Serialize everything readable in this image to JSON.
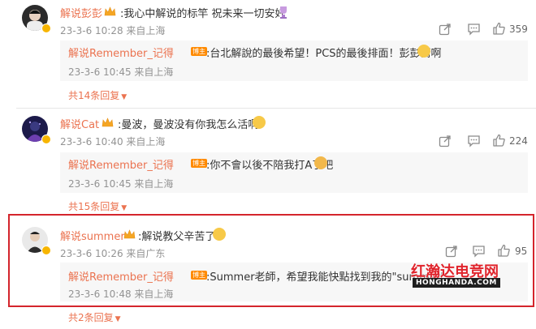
{
  "comments": [
    {
      "user": "解说彭彭",
      "text": ":我心中解说的标竿 祝未来一切安好",
      "time": "23-3-6 10:28 来自上海",
      "likes": "359",
      "reply": {
        "user": "解说Remember_记得",
        "tag": "博主",
        "text": ":台北解說的最後希望！PCS的最後排面！彭彭衝啊",
        "time": "23-3-6 10:45 来自上海"
      },
      "more": "共14条回复"
    },
    {
      "user": "解说Cat",
      "text": ":曼波，曼波没有你我怎么活啊",
      "time": "23-3-6 10:40 来自上海",
      "likes": "224",
      "reply": {
        "user": "解说Remember_记得",
        "tag": "博主",
        "text": ":你不會以後不陪我打A了吧",
        "time": "23-3-6 10:45 来自上海"
      },
      "more": "共15条回复"
    },
    {
      "user": "解说summer",
      "text": ":解说教父辛苦了",
      "time": "23-3-6 10:26 来自广东",
      "likes": "95",
      "reply": {
        "user": "解说Remember_记得",
        "tag": "博主",
        "text": ":Summer老師，希望我能快點找到我的\"summer\"",
        "time": "23-3-6 10:48 来自上海"
      },
      "more": "共2条回复"
    }
  ],
  "watermark": {
    "title": "红瀚达电竞网",
    "url": "HONGHANDA.COM"
  },
  "colors": {
    "username": "#eb7350",
    "highlight_border": "#d4252c",
    "tag": "#ff8a00"
  },
  "icons": [
    "share-icon",
    "comment-icon",
    "like-icon",
    "crown-icon",
    "verified-badge-icon"
  ]
}
